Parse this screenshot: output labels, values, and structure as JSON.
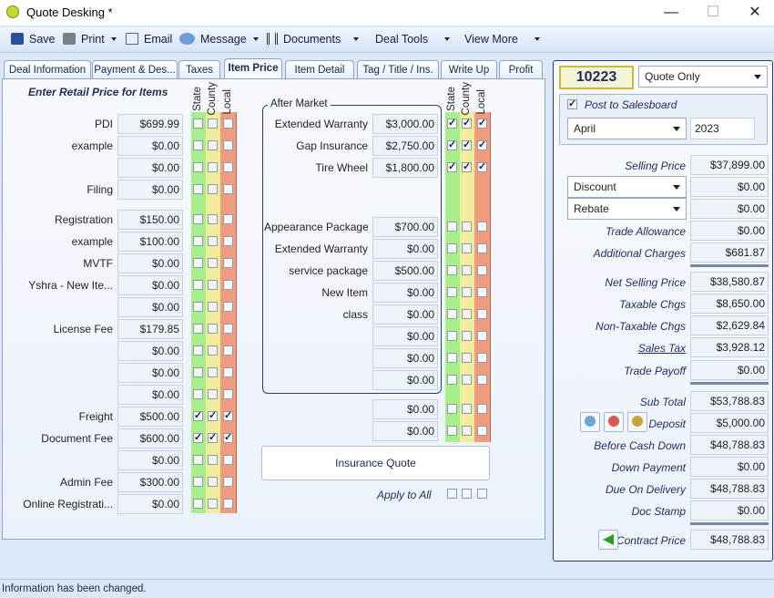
{
  "window": {
    "title": "Quote Desking *",
    "minimize": "—",
    "maximize": "☐",
    "close": "✕"
  },
  "toolbar": [
    {
      "label": "Save",
      "icon": "save-icon",
      "dropdown": false
    },
    {
      "label": "Print",
      "icon": "print-icon",
      "dropdown": true
    },
    {
      "label": "Email",
      "icon": "email-icon",
      "dropdown": false
    },
    {
      "label": "Message",
      "icon": "message-icon",
      "dropdown": true
    },
    {
      "label": "Documents",
      "icon": "documents-icon",
      "dropdown": true
    },
    {
      "label": "Deal Tools",
      "icon": "",
      "dropdown": true
    },
    {
      "label": "View More",
      "icon": "",
      "dropdown": true
    }
  ],
  "tabs": [
    "Deal Information",
    "Payment & Des...",
    "Taxes",
    "Item Price",
    "Item Detail",
    "Tag / Title / Ins.",
    "Write Up",
    "Profit"
  ],
  "active_tab": "Item Price",
  "retail": {
    "header": "Enter Retail Price for Items",
    "columns": [
      "State",
      "County",
      "Local"
    ],
    "rows": [
      {
        "label": "PDI",
        "value": "$699.99",
        "checks": [
          false,
          false,
          false
        ]
      },
      {
        "label": "example",
        "value": "$0.00",
        "checks": [
          false,
          false,
          false
        ]
      },
      {
        "label": "",
        "value": "$0.00",
        "checks": [
          false,
          false,
          false
        ]
      },
      {
        "label": "Filing",
        "value": "$0.00",
        "checks": [
          false,
          false,
          false
        ]
      },
      {
        "label": "Registration",
        "value": "$150.00",
        "checks": [
          false,
          false,
          false
        ]
      },
      {
        "label": "example",
        "value": "$100.00",
        "checks": [
          false,
          false,
          false
        ]
      },
      {
        "label": "MVTF",
        "value": "$0.00",
        "checks": [
          false,
          false,
          false
        ]
      },
      {
        "label": "Yshra - New Ite...",
        "value": "$0.00",
        "checks": [
          false,
          false,
          false
        ]
      },
      {
        "label": "",
        "value": "$0.00",
        "checks": [
          false,
          false,
          false
        ]
      },
      {
        "label": "License Fee",
        "value": "$179.85",
        "checks": [
          false,
          false,
          false
        ]
      },
      {
        "label": "",
        "value": "$0.00",
        "checks": [
          false,
          false,
          false
        ]
      },
      {
        "label": "",
        "value": "$0.00",
        "checks": [
          false,
          false,
          false
        ]
      },
      {
        "label": "",
        "value": "$0.00",
        "checks": [
          false,
          false,
          false
        ]
      },
      {
        "label": "Freight",
        "value": "$500.00",
        "checks": [
          true,
          true,
          true
        ]
      },
      {
        "label": "Document Fee",
        "value": "$600.00",
        "checks": [
          true,
          true,
          true
        ]
      },
      {
        "label": "",
        "value": "$0.00",
        "checks": [
          false,
          false,
          false
        ]
      },
      {
        "label": "Admin Fee",
        "value": "$300.00",
        "checks": [
          false,
          false,
          false
        ]
      },
      {
        "label": "Online Registrati...",
        "value": "$0.00",
        "checks": [
          false,
          false,
          false
        ]
      }
    ]
  },
  "aftermarket": {
    "legend": "After Market",
    "columns": [
      "State",
      "County",
      "Local"
    ],
    "rows": [
      {
        "label": "Extended Warranty",
        "value": "$3,000.00",
        "checks": [
          true,
          true,
          true
        ]
      },
      {
        "label": "Gap Insurance",
        "value": "$2,750.00",
        "checks": [
          true,
          true,
          true
        ]
      },
      {
        "label": "Tire  Wheel",
        "value": "$1,800.00",
        "checks": [
          true,
          true,
          true
        ]
      },
      {
        "label": "Appearance Package",
        "value": "$700.00",
        "checks": [
          false,
          false,
          false
        ]
      },
      {
        "label": "Extended Warranty",
        "value": "$0.00",
        "checks": [
          false,
          false,
          false
        ]
      },
      {
        "label": "service package",
        "value": "$500.00",
        "checks": [
          false,
          false,
          false
        ]
      },
      {
        "label": "New Item",
        "value": "$0.00",
        "checks": [
          false,
          false,
          false
        ]
      },
      {
        "label": "class",
        "value": "$0.00",
        "checks": [
          false,
          false,
          false
        ]
      },
      {
        "label": "",
        "value": "$0.00",
        "checks": [
          false,
          false,
          false
        ]
      },
      {
        "label": "",
        "value": "$0.00",
        "checks": [
          false,
          false,
          false
        ]
      },
      {
        "label": "",
        "value": "$0.00",
        "checks": [
          false,
          false,
          false
        ]
      },
      {
        "label": "",
        "value": "$0.00",
        "checks": [
          false,
          false,
          false
        ]
      },
      {
        "label": "",
        "value": "$0.00",
        "checks": [
          false,
          false,
          false
        ]
      }
    ],
    "insurance_quote": "Insurance Quote",
    "apply_to_all": "Apply to All"
  },
  "summary": {
    "deal_number": "10223",
    "quote_type": "Quote Only",
    "post_to_salesboard": "Post to Salesboard",
    "post_checked": true,
    "month": "April",
    "year": "2023",
    "selling_price_label": "Selling Price",
    "selling_price": "$37,899.00",
    "discount_label": "Discount",
    "discount": "$0.00",
    "rebate_label": "Rebate",
    "rebate": "$0.00",
    "trade_allowance_label": "Trade Allowance",
    "trade_allowance": "$0.00",
    "additional_charges_label": "Additional Charges",
    "additional_charges": "$681.87",
    "net_selling_price_label": "Net Selling Price",
    "net_selling_price": "$38,580.87",
    "taxable_chgs_label": "Taxable Chgs",
    "taxable_chgs": "$8,650.00",
    "non_taxable_chgs_label": "Non-Taxable Chgs",
    "non_taxable_chgs": "$2,629.84",
    "sales_tax_label": "Sales Tax",
    "sales_tax": "$3,928.12",
    "trade_payoff_label": "Trade Payoff",
    "trade_payoff": "$0.00",
    "sub_total_label": "Sub Total",
    "sub_total": "$53,788.83",
    "deposit_label": "Deposit",
    "deposit": "$5,000.00",
    "before_cash_down_label": "Before Cash Down",
    "before_cash_down": "$48,788.83",
    "down_payment_label": "Down Payment",
    "down_payment": "$0.00",
    "due_on_delivery_label": "Due On Delivery",
    "due_on_delivery": "$48,788.83",
    "doc_stamp_label": "Doc Stamp",
    "doc_stamp": "$0.00",
    "contract_price_label": "Contract Price",
    "contract_price": "$48,788.83"
  },
  "status": "Information has been changed.",
  "colors": {
    "state": "#a8ee8c",
    "county": "#f1ec9e",
    "local": "#ef9d7e",
    "accent": "#1d2c5a"
  }
}
